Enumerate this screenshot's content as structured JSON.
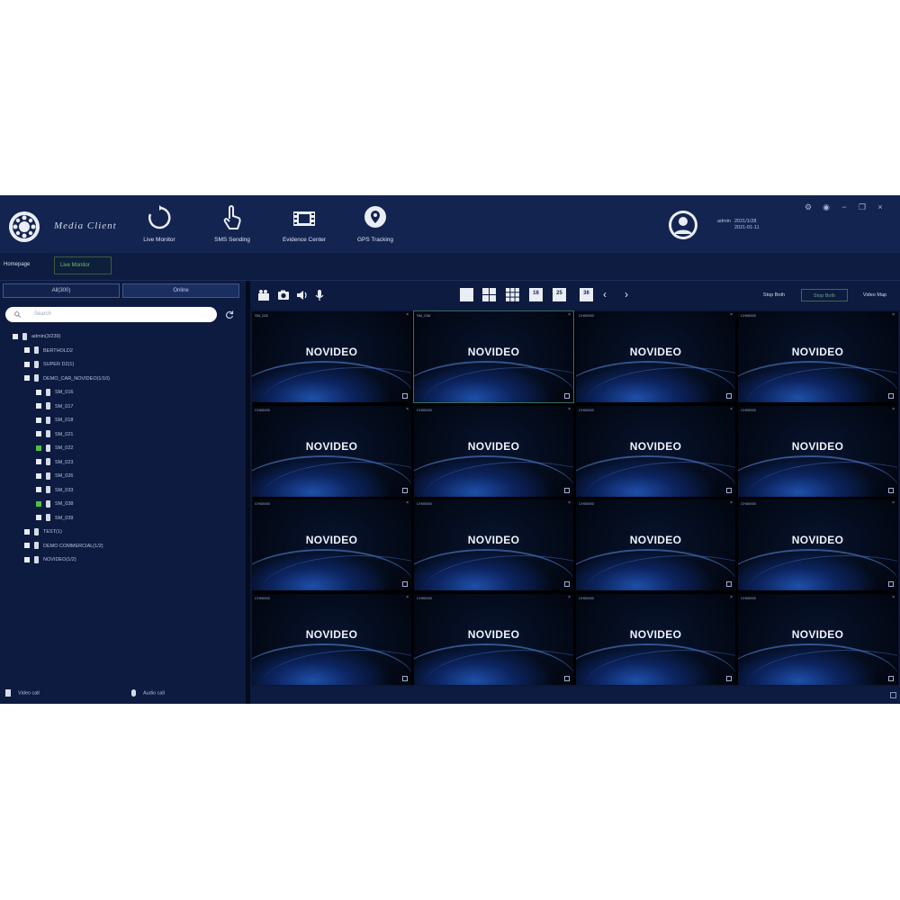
{
  "app": {
    "brand": "Media Client"
  },
  "nav": [
    {
      "label": "Live Monitor",
      "icon": "refresh-circle-icon"
    },
    {
      "label": "SMS Sending",
      "icon": "hand-pointer-icon"
    },
    {
      "label": "Evidence Center",
      "icon": "film-icon"
    },
    {
      "label": "GPS Tracking",
      "icon": "map-pin-icon"
    }
  ],
  "user": {
    "name": "admin",
    "line1": "2021/1/28",
    "line2": "2021-01-11"
  },
  "window_controls": [
    "settings-icon",
    "info-icon",
    "minimize-icon",
    "restore-icon",
    "close-icon"
  ],
  "breadcrumb": {
    "home": "Homepage",
    "current": "Live Monitor"
  },
  "left": {
    "tabs": [
      {
        "label": "All(300)"
      },
      {
        "label": "Online"
      }
    ],
    "search_placeholder": "Search",
    "tree": [
      {
        "label": "admin(3/239)",
        "level": 0,
        "checked": false
      },
      {
        "label": "BERTHOLD2",
        "level": 1,
        "checked": false
      },
      {
        "label": "SUPER D2(1)",
        "level": 1,
        "checked": false
      },
      {
        "label": "DEMO_CAR_NOVIDEO(1/10)",
        "level": 1,
        "checked": false
      },
      {
        "label": "SM_016",
        "level": 2,
        "checked": false
      },
      {
        "label": "SM_017",
        "level": 2,
        "checked": false
      },
      {
        "label": "SM_018",
        "level": 2,
        "checked": false
      },
      {
        "label": "SM_021",
        "level": 2,
        "checked": false
      },
      {
        "label": "SM_022",
        "level": 2,
        "checked": true
      },
      {
        "label": "SM_023",
        "level": 2,
        "checked": false
      },
      {
        "label": "SM_026",
        "level": 2,
        "checked": false
      },
      {
        "label": "SM_033",
        "level": 2,
        "checked": false
      },
      {
        "label": "SM_038",
        "level": 2,
        "checked": true
      },
      {
        "label": "SM_039",
        "level": 2,
        "checked": false
      },
      {
        "label": "TEST(1)",
        "level": 1,
        "checked": false
      },
      {
        "label": "DEMO COMMERCIAL(1/2)",
        "level": 1,
        "checked": false
      },
      {
        "label": "NOVIDEO(1/2)",
        "level": 1,
        "checked": false
      }
    ],
    "bottom": {
      "video_call": "Video call",
      "audio_call": "Audio call"
    }
  },
  "toolbar": {
    "tools": [
      "record-icon",
      "snapshot-icon",
      "speaker-icon",
      "microphone-icon"
    ],
    "layouts": [
      {
        "n": "",
        "icon": "layout-1-icon"
      },
      {
        "n": "",
        "icon": "layout-4-icon"
      },
      {
        "n": "",
        "icon": "layout-9-icon"
      },
      {
        "n": "16",
        "icon": "layout-16-icon"
      },
      {
        "n": "25",
        "icon": "layout-25-icon"
      },
      {
        "n": "36",
        "icon": "layout-36-icon"
      }
    ],
    "prev": "‹",
    "next": "›",
    "right_buttons": [
      {
        "label": "Stop Both",
        "active": false
      },
      {
        "label": "Stop Both",
        "active": true
      },
      {
        "label": "Video Map",
        "active": false
      }
    ]
  },
  "grid": {
    "cells": [
      {
        "label": "SM_022",
        "logo": "NOVIDEO",
        "selected": false
      },
      {
        "label": "SM_038",
        "logo": "NOVIDEO",
        "selected": true
      },
      {
        "label": "CH00000",
        "logo": "NOVIDEO",
        "selected": false
      },
      {
        "label": "CH00000",
        "logo": "NOVIDEO",
        "selected": false
      },
      {
        "label": "CH00000",
        "logo": "NOVIDEO",
        "selected": false
      },
      {
        "label": "CH00000",
        "logo": "NOVIDEO",
        "selected": false
      },
      {
        "label": "CH00000",
        "logo": "NOVIDEO",
        "selected": false
      },
      {
        "label": "CH00000",
        "logo": "NOVIDEO",
        "selected": false
      },
      {
        "label": "CH00000",
        "logo": "NOVIDEO",
        "selected": false
      },
      {
        "label": "CH00000",
        "logo": "NOVIDEO",
        "selected": false
      },
      {
        "label": "CH00000",
        "logo": "NOVIDEO",
        "selected": false
      },
      {
        "label": "CH00000",
        "logo": "NOVIDEO",
        "selected": false
      },
      {
        "label": "CH00000",
        "logo": "NOVIDEO",
        "selected": false
      },
      {
        "label": "CH00000",
        "logo": "NOVIDEO",
        "selected": false
      },
      {
        "label": "CH00000",
        "logo": "NOVIDEO",
        "selected": false
      },
      {
        "label": "CH00000",
        "logo": "NOVIDEO",
        "selected": false
      }
    ],
    "close_glyph": "×"
  },
  "colors": {
    "header": "#142450",
    "panel": "#0d1b40",
    "accent_green": "#4fbf4a"
  }
}
